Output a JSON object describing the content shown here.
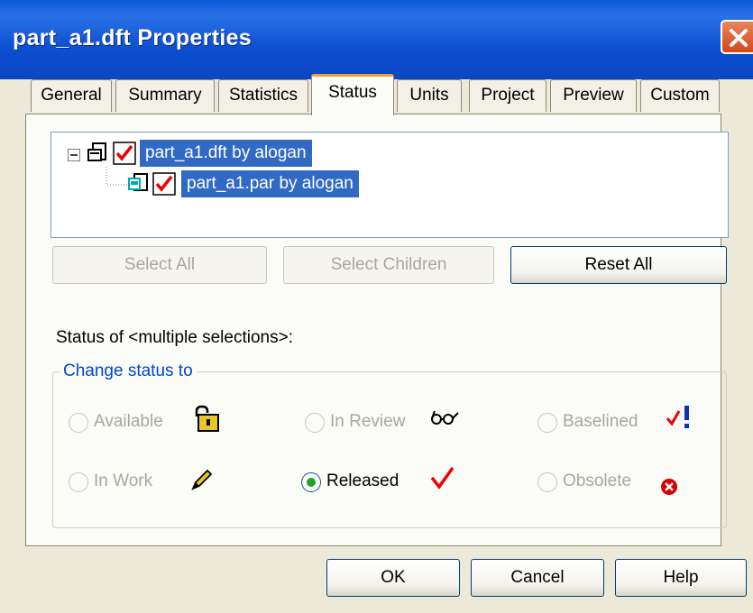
{
  "window": {
    "title": "part_a1.dft Properties"
  },
  "tabs": [
    {
      "label": "General"
    },
    {
      "label": "Summary"
    },
    {
      "label": "Statistics"
    },
    {
      "label": "Status"
    },
    {
      "label": "Units"
    },
    {
      "label": "Project"
    },
    {
      "label": "Preview"
    },
    {
      "label": "Custom"
    }
  ],
  "active_tab": "Status",
  "tree": {
    "items": [
      {
        "label": "part_a1.dft by alogan",
        "icon": "draft-doc-icon"
      },
      {
        "label": "part_a1.par by alogan",
        "icon": "part-doc-icon"
      }
    ]
  },
  "buttons": {
    "select_all": "Select All",
    "select_children": "Select Children",
    "reset_all": "Reset All",
    "ok": "OK",
    "cancel": "Cancel",
    "help": "Help"
  },
  "status_label": "Status of  <multiple selections>:",
  "change_group": {
    "legend": "Change status to",
    "options": [
      {
        "label": "Available",
        "icon": "padlock-icon",
        "checked": false
      },
      {
        "label": "In Review",
        "icon": "glasses-icon",
        "checked": false
      },
      {
        "label": "Baselined",
        "icon": "check-exclaim-icon",
        "checked": false
      },
      {
        "label": "In Work",
        "icon": "pencil-icon",
        "checked": false
      },
      {
        "label": "Released",
        "icon": "red-check-icon",
        "checked": true
      },
      {
        "label": "Obsolete",
        "icon": "red-x-icon",
        "checked": false
      }
    ]
  },
  "colors": {
    "titlebar": "#0a58d6",
    "selection": "#316ac5",
    "accent": "#f0a030"
  }
}
